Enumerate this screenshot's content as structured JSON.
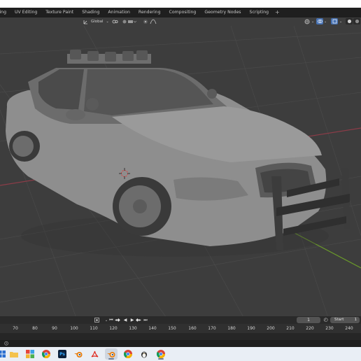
{
  "workspace_tabs": [
    "lling",
    "UV Editing",
    "Texture Paint",
    "Shading",
    "Animation",
    "Rendering",
    "Compositing",
    "Geometry Nodes",
    "Scripting",
    "+"
  ],
  "header": {
    "transform_orientation": "Global"
  },
  "timeline": {
    "current_frame": "1",
    "start_label": "Start",
    "start_value": "1",
    "ruler_ticks": [
      "70",
      "80",
      "90",
      "100",
      "110",
      "120",
      "130",
      "140",
      "150",
      "160",
      "170",
      "180",
      "190",
      "200",
      "210",
      "220",
      "230",
      "240"
    ]
  },
  "status": {
    "indicator": "🛈"
  },
  "taskbar": {
    "apps": [
      "start-icon",
      "file-explorer-icon",
      "photo-app-icon",
      "chrome-icon",
      "photoshop-icon",
      "blender-icon",
      "acrobat-icon",
      "blender-icon",
      "chrome-icon",
      "linux-icon",
      "chrome-icon"
    ],
    "photoshop_text": "Ps"
  },
  "colors": {
    "viewport_bg": "#3d3d3d",
    "grid_line": "#4a4a4a",
    "x_axis": "#8c3c48",
    "y_axis": "#6a9a2a",
    "car_body": "#8e8e8e",
    "active_blue": "#4772b3"
  }
}
